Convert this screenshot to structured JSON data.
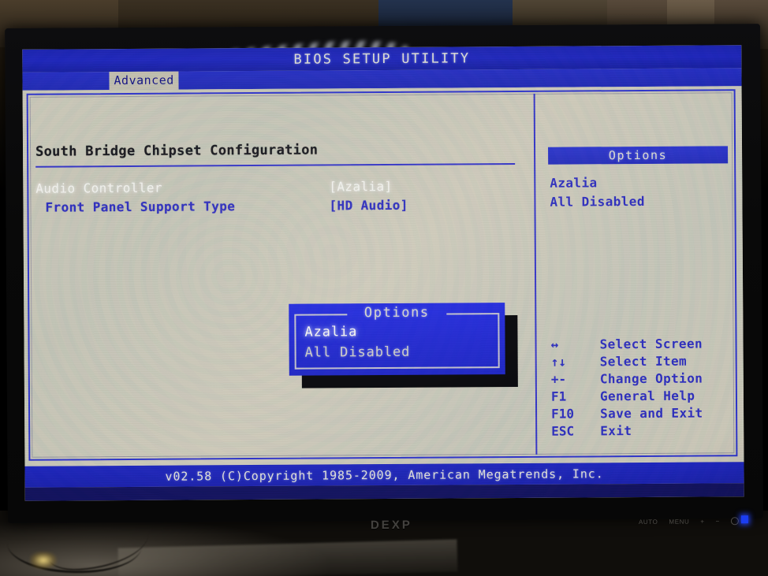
{
  "screen": {
    "title": "BIOS SETUP UTILITY",
    "menu_tabs": [
      {
        "label": "Advanced",
        "active": true
      }
    ],
    "section_title": "South Bridge Chipset Configuration",
    "settings": [
      {
        "label": "Audio Controller",
        "value": "[Azalia]",
        "selected": true
      },
      {
        "label": "Front Panel Support Type",
        "value": "[HD Audio]",
        "selected": false
      }
    ],
    "side_panel": {
      "header": "Options",
      "options": [
        "Azalia",
        "All Disabled"
      ]
    },
    "legend": {
      "rows": [
        {
          "key": "↔",
          "desc": "Select Screen"
        },
        {
          "key": "↑↓",
          "desc": "Select Item"
        },
        {
          "key": "+-",
          "desc": "Change Option"
        },
        {
          "key": "F1",
          "desc": "General Help"
        },
        {
          "key": "F10",
          "desc": "Save and Exit"
        },
        {
          "key": "ESC",
          "desc": "Exit"
        }
      ]
    },
    "footer": "v02.58 (C)Copyright 1985-2009, American Megatrends, Inc.",
    "popup": {
      "title": "Options",
      "items": [
        {
          "label": "Azalia",
          "selected": true
        },
        {
          "label": "All Disabled",
          "selected": false
        }
      ]
    }
  },
  "monitor": {
    "brand": "DEXP",
    "osd_buttons": [
      "AUTO",
      "MENU",
      "+",
      "−"
    ],
    "power_button_icon": "power-circle-icon",
    "power_led_color": "#1b3df2"
  },
  "colors": {
    "bios_blue": "#1d24b4",
    "bios_gray": "#c3c0b0",
    "text_blue": "#2a2ab6",
    "highlight_white": "#eeeeea"
  }
}
